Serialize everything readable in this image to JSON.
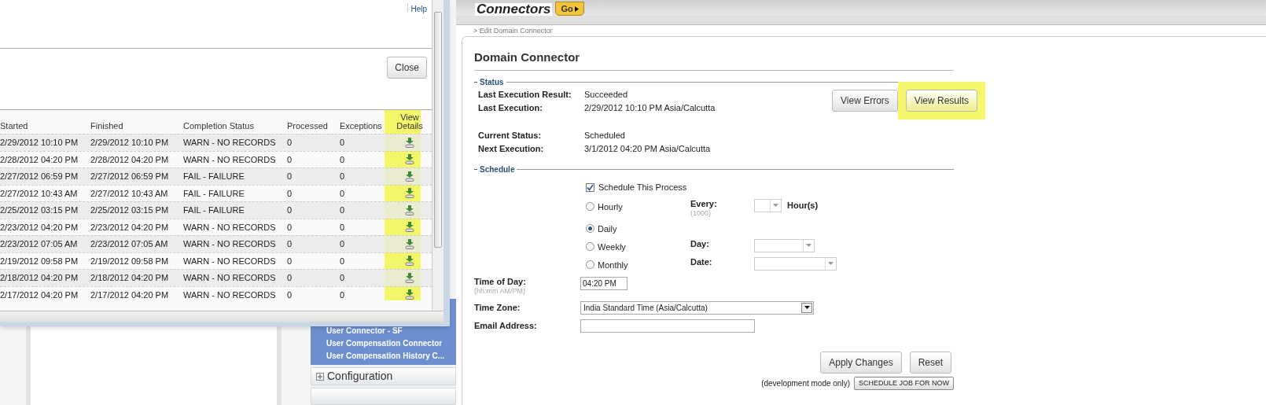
{
  "popup": {
    "help_link": "Help",
    "close_button": "Close",
    "table": {
      "columns": [
        "Started",
        "Finished",
        "Completion Status",
        "Processed",
        "Exceptions",
        "View Details"
      ],
      "rows": [
        {
          "started": "2/29/2012 10:10 PM",
          "finished": "2/29/2012 10:10 PM",
          "status": "WARN - NO RECORDS",
          "processed": "0",
          "exceptions": "0"
        },
        {
          "started": "2/28/2012 04:20 PM",
          "finished": "2/28/2012 04:20 PM",
          "status": "WARN - NO RECORDS",
          "processed": "0",
          "exceptions": "0"
        },
        {
          "started": "2/27/2012 06:59 PM",
          "finished": "2/27/2012 06:59 PM",
          "status": "FAIL - FAILURE",
          "processed": "0",
          "exceptions": "0"
        },
        {
          "started": "2/27/2012 10:43 AM",
          "finished": "2/27/2012 10:43 AM",
          "status": "FAIL - FAILURE",
          "processed": "0",
          "exceptions": "0"
        },
        {
          "started": "2/25/2012 03:15 PM",
          "finished": "2/25/2012 03:15 PM",
          "status": "FAIL - FAILURE",
          "processed": "0",
          "exceptions": "0"
        },
        {
          "started": "2/23/2012 04:20 PM",
          "finished": "2/23/2012 04:20 PM",
          "status": "WARN - NO RECORDS",
          "processed": "0",
          "exceptions": "0"
        },
        {
          "started": "2/23/2012 07:05 AM",
          "finished": "2/23/2012 07:05 AM",
          "status": "WARN - NO RECORDS",
          "processed": "0",
          "exceptions": "0"
        },
        {
          "started": "2/19/2012 09:58 PM",
          "finished": "2/19/2012 09:58 PM",
          "status": "WARN - NO RECORDS",
          "processed": "0",
          "exceptions": "0"
        },
        {
          "started": "2/18/2012 04:20 PM",
          "finished": "2/18/2012 04:20 PM",
          "status": "WARN - NO RECORDS",
          "processed": "0",
          "exceptions": "0"
        },
        {
          "started": "2/17/2012 04:20 PM",
          "finished": "2/17/2012 04:20 PM",
          "status": "WARN - NO RECORDS",
          "processed": "0",
          "exceptions": "0"
        }
      ]
    }
  },
  "sidebar": {
    "items": [
      "User Connector - SF",
      "User Compensation Connector",
      "User Compensation History C..."
    ],
    "sections": [
      {
        "label": "Configuration",
        "expanded": false
      }
    ]
  },
  "header": {
    "title": "Connectors",
    "go_button": "Go"
  },
  "breadcrumb": "> Edit Domain Connector",
  "form": {
    "title": "Domain Connector",
    "status": {
      "legend": "Status",
      "fields": [
        {
          "label": "Last Execution Result:",
          "value": "Succeeded"
        },
        {
          "label": "Last Execution:",
          "value": "2/29/2012 10:10 PM Asia/Calcutta"
        },
        {
          "label": "Current Status:",
          "value": "Scheduled"
        },
        {
          "label": "Next Execution:",
          "value": "3/1/2012 04:20 PM Asia/Calcutta"
        }
      ],
      "buttons": [
        {
          "label": "View Errors",
          "highlighted": false
        },
        {
          "label": "View Results",
          "highlighted": true
        }
      ]
    },
    "schedule": {
      "legend": "Schedule",
      "checkbox": {
        "label": "Schedule This Process",
        "checked": true
      },
      "frequencies": [
        {
          "label": "Hourly",
          "selected": false,
          "field": {
            "label": "Every:",
            "hint": "(1000)",
            "unit": "Hour(s)"
          }
        },
        {
          "label": "Daily",
          "selected": true
        },
        {
          "label": "Weekly",
          "selected": false,
          "field": {
            "label": "Day:"
          }
        },
        {
          "label": "Monthly",
          "selected": false,
          "field": {
            "label": "Date:"
          }
        }
      ],
      "time_of_day": {
        "label": "Time of Day:",
        "hint": "(hh:mm AM/PM)",
        "value": "04:20 PM"
      },
      "time_zone": {
        "label": "Time Zone:",
        "value": "India Standard Time (Asia/Calcutta)"
      },
      "email": {
        "label": "Email Address:"
      }
    },
    "actions": [
      "Apply Changes",
      "Reset"
    ],
    "dev_note": "(development mode only)",
    "dev_button": "SCHEDULE JOB FOR NOW"
  }
}
